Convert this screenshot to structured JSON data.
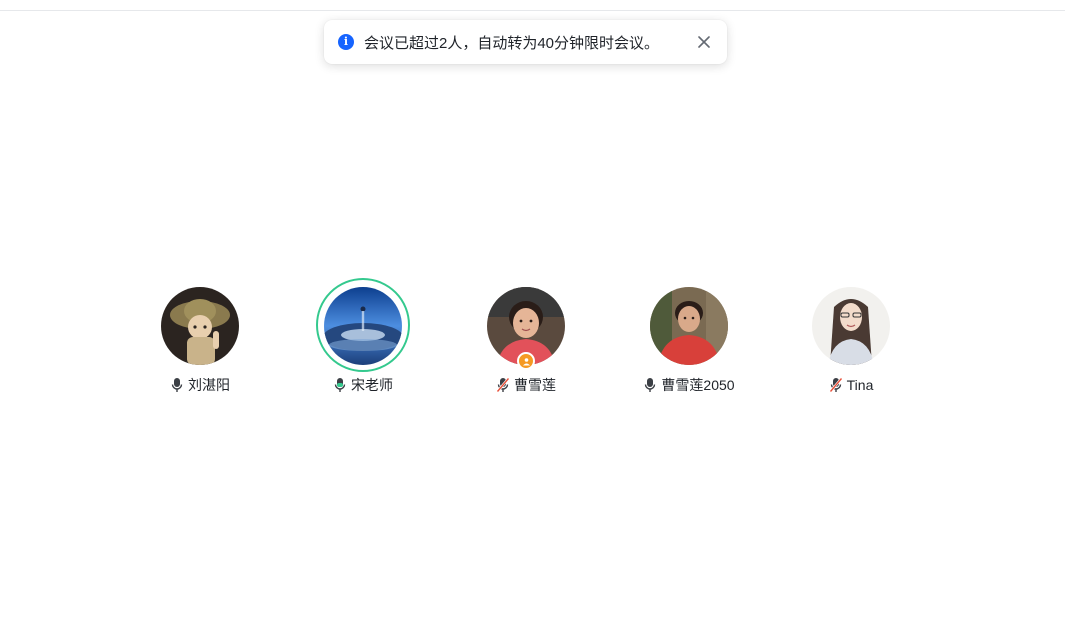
{
  "notification": {
    "icon": "info-icon",
    "message": "会议已超过2人，自动转为40分钟限时会议。",
    "close_icon": "close-icon"
  },
  "participants": [
    {
      "name": "刘湛阳",
      "mic": "microphone-on",
      "speaking": false,
      "host": false
    },
    {
      "name": "宋老师",
      "mic": "microphone-on",
      "speaking": true,
      "host": false
    },
    {
      "name": "曹雪莲",
      "mic": "microphone-muted",
      "speaking": false,
      "host": true
    },
    {
      "name": "曹雪莲2050",
      "mic": "microphone-on",
      "speaking": false,
      "host": false
    },
    {
      "name": "Tina",
      "mic": "microphone-muted",
      "speaking": false,
      "host": false
    }
  ],
  "colors": {
    "accent": "#1664ff",
    "speaking_ring": "#34c98e",
    "host_badge": "#f59a23",
    "muted_slash": "#e8503a"
  }
}
